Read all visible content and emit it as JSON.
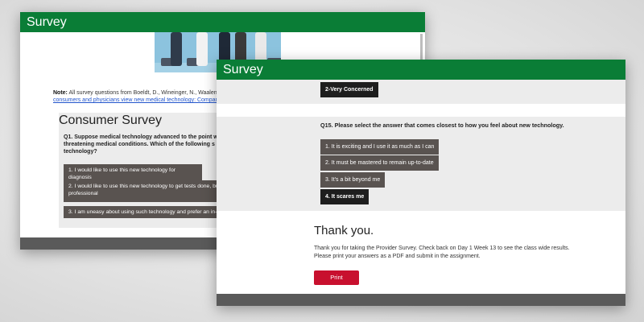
{
  "back_window": {
    "title": "Survey",
    "note_label": "Note:",
    "note_text": "All survey questions from Boeldt, D., Wineinger, N., Waalen, J.",
    "note_link": "consumers and physicians view new medical technology: Comparat",
    "card_title": "Consumer Survey",
    "question": "Q1. Suppose medical technology advanced to the point whe life-threatening medical conditions. Which of the following s new technology?",
    "options": [
      "1. I would like to use this new technology for diagnosis",
      "2. I would like to use this new technology to get tests done, bu professional",
      "3. I am uneasy about using such technology and prefer an in-p"
    ]
  },
  "front_window": {
    "title": "Survey",
    "prev_answer": "2-Very Concerned",
    "question": "Q15. Please select the answer that comes closest to how you feel about new technology.",
    "options": [
      {
        "label": "1. It is exciting and I use it as much as I can",
        "selected": false
      },
      {
        "label": "2. It must be mastered to remain up-to-date",
        "selected": false
      },
      {
        "label": "3. It's a bit beyond me",
        "selected": false
      },
      {
        "label": "4. It scares me",
        "selected": true
      }
    ],
    "thanks_title": "Thank you.",
    "thanks_line1": "Thank you for taking the Provider Survey. Check back on Day 1 Week 13 to see the class wide results.",
    "thanks_line2": "Please print your answers as a PDF and submit in the assignment.",
    "print_label": "Print"
  },
  "colors": {
    "header_green": "#0a7d36",
    "option_gray": "#595350",
    "option_selected": "#1e1e1e",
    "print_red": "#c8102e",
    "footer_gray": "#5a5a5a"
  }
}
